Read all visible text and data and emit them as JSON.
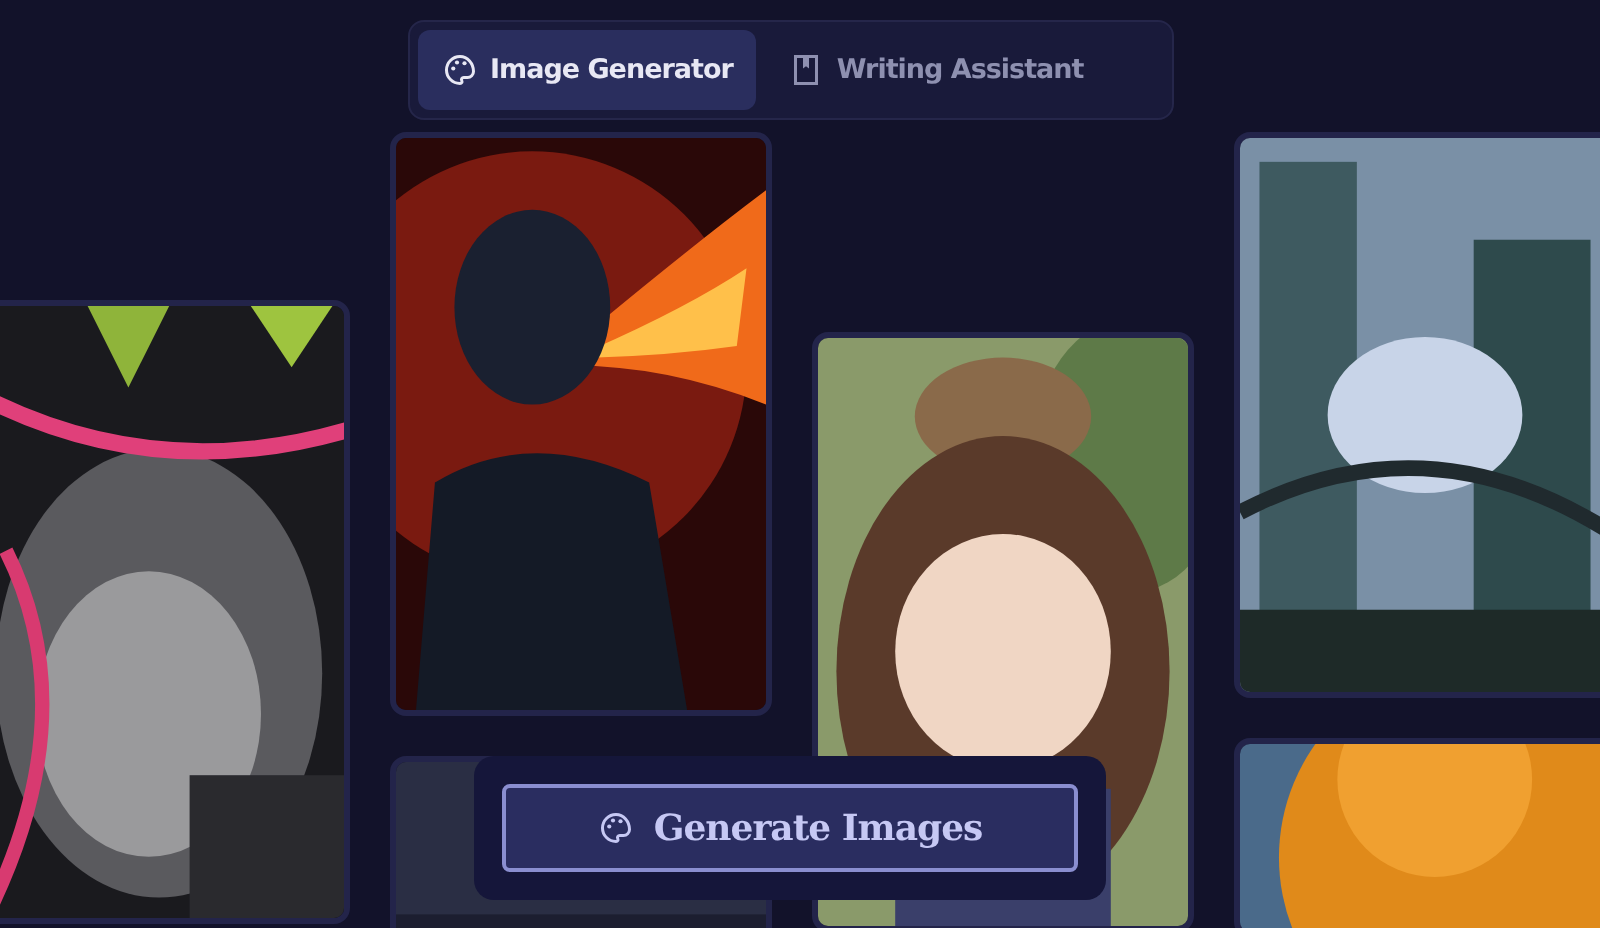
{
  "tabs": [
    {
      "label": "Image Generator",
      "selected": true
    },
    {
      "label": "Writing Assistant",
      "selected": false
    }
  ],
  "generate_button": {
    "label": "Generate Images"
  }
}
